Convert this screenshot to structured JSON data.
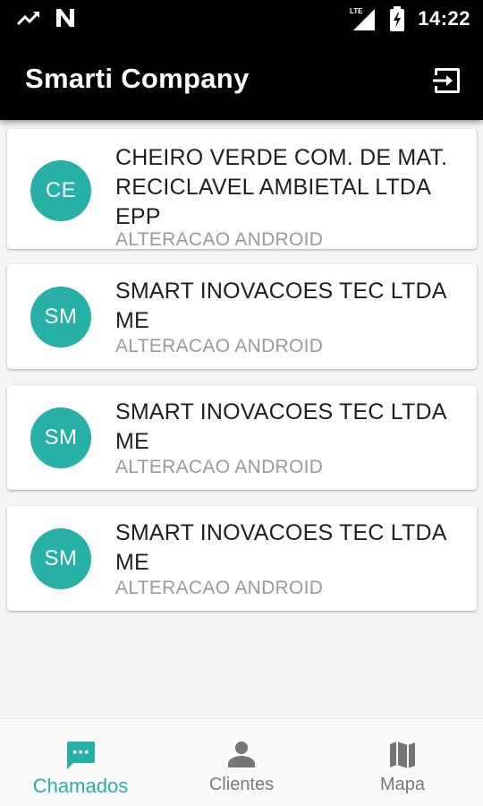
{
  "status_bar": {
    "time": "14:22",
    "network": "LTE"
  },
  "app_bar": {
    "title": "Smarti Company",
    "action_icon": "logout-icon"
  },
  "colors": {
    "accent": "#26b0a6",
    "app_bar": "#000000"
  },
  "cards": [
    {
      "initials": "CE",
      "name": "CHEIRO VERDE COM. DE MAT. RECICLAVEL AMBIETAL LTDA EPP",
      "subtitle": "ALTERACAO ANDROID"
    },
    {
      "initials": "SM",
      "name": "SMART INOVACOES TEC LTDA ME",
      "subtitle": "ALTERACAO ANDROID"
    },
    {
      "initials": "SM",
      "name": "SMART INOVACOES TEC LTDA ME",
      "subtitle": "ALTERACAO ANDROID"
    },
    {
      "initials": "SM",
      "name": "SMART INOVACOES TEC LTDA ME",
      "subtitle": "ALTERACAO ANDROID"
    }
  ],
  "bottom_nav": [
    {
      "label": "Chamados",
      "icon": "chat-icon",
      "active": true
    },
    {
      "label": "Clientes",
      "icon": "person-icon",
      "active": false
    },
    {
      "label": "Mapa",
      "icon": "map-icon",
      "active": false
    }
  ]
}
